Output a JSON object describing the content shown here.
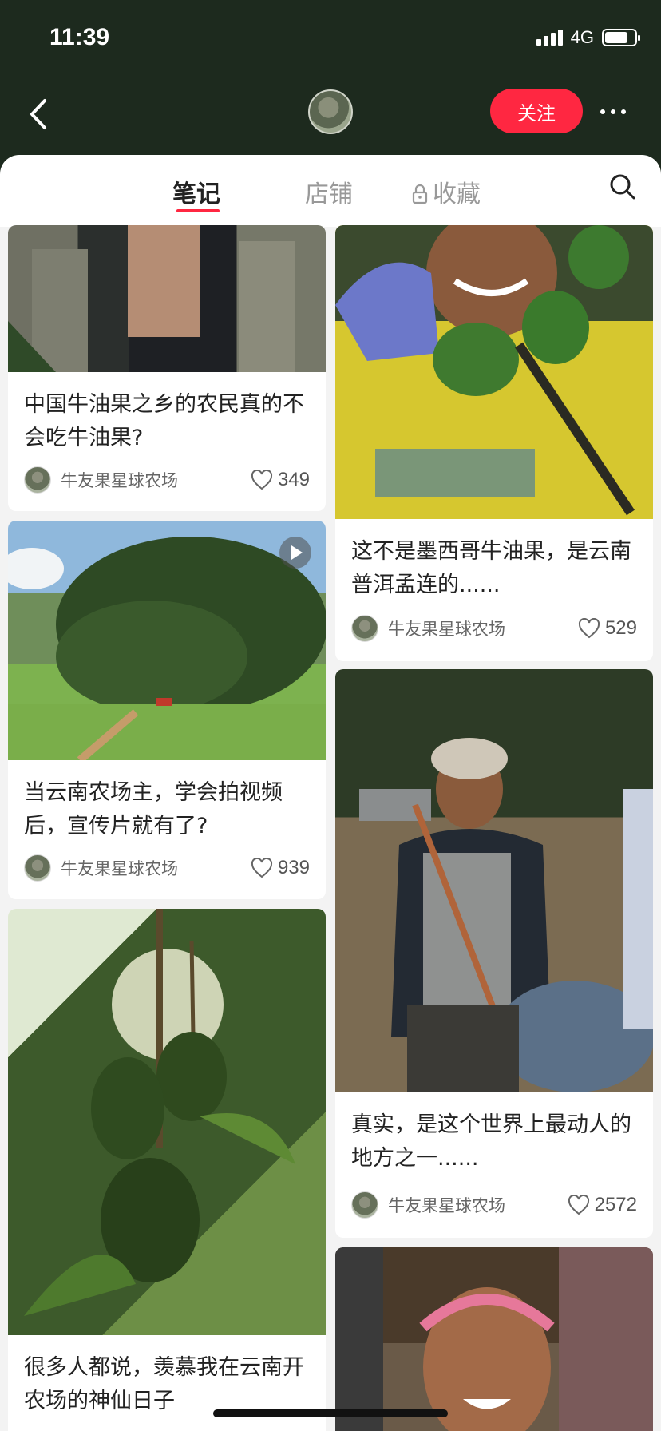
{
  "status": {
    "time": "11:39",
    "network": "4G"
  },
  "header": {
    "follow_label": "关注"
  },
  "tabs": [
    {
      "label": "笔记"
    },
    {
      "label": "店铺"
    },
    {
      "label": "收藏"
    }
  ],
  "colors": {
    "accent": "#ff2741",
    "header_bg": "#1d2a1e"
  },
  "notes": [
    {
      "title": "中国牛油果之乡的农民真的不会吃牛油果?",
      "author": "牛友果星球农场",
      "likes": "349"
    },
    {
      "title": "这不是墨西哥牛油果，是云南普洱孟连的......",
      "author": "牛友果星球农场",
      "likes": "529"
    },
    {
      "title": "当云南农场主，学会拍视频后，宣传片就有了?",
      "author": "牛友果星球农场",
      "likes": "939"
    },
    {
      "title": "真实，是这个世界上最动人的地方之一......",
      "author": "牛友果星球农场",
      "likes": "2572"
    },
    {
      "title": "很多人都说，羡慕我在云南开农场的神仙日子"
    }
  ]
}
